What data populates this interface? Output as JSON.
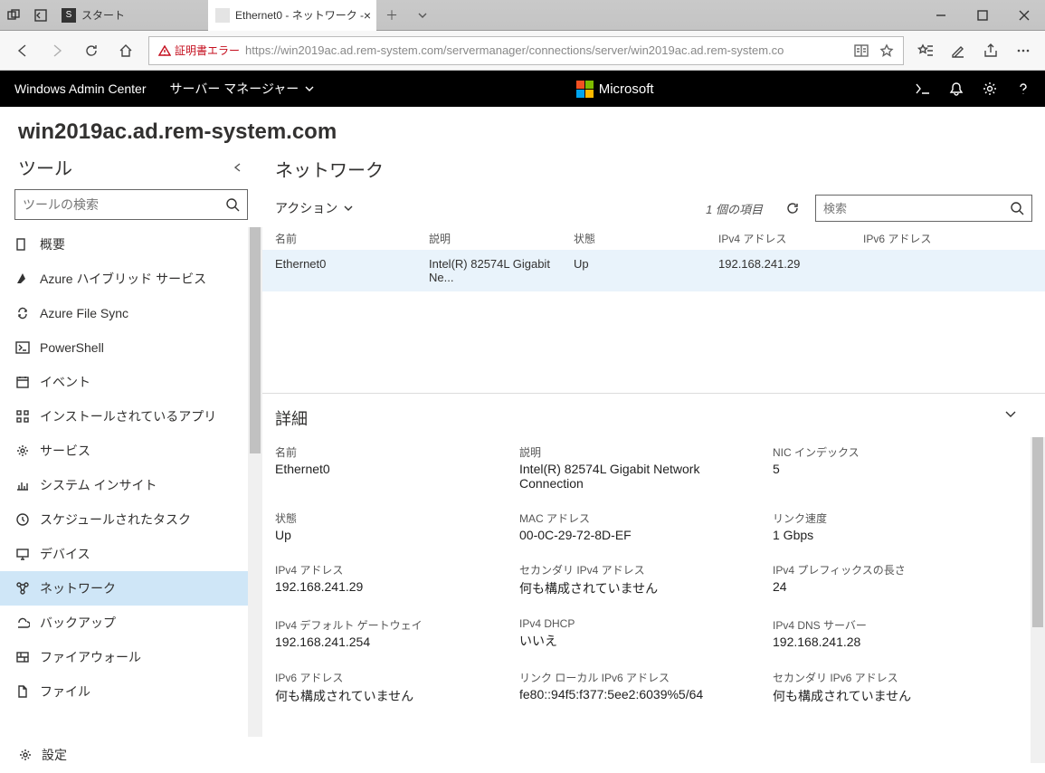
{
  "titlebar": {
    "tab1": "スタート",
    "tab2": "Ethernet0 - ネットワーク - "
  },
  "toolbar": {
    "cert_error": "証明書エラー",
    "url": "https://win2019ac.ad.rem-system.com/servermanager/connections/server/win2019ac.ad.rem-system.co"
  },
  "wac": {
    "title": "Windows Admin Center",
    "subtitle": "サーバー マネージャー",
    "brand": "Microsoft"
  },
  "server_name": "win2019ac.ad.rem-system.com",
  "tools": {
    "heading": "ツール",
    "search_placeholder": "ツールの検索",
    "items": [
      "概要",
      "Azure ハイブリッド サービス",
      "Azure File Sync",
      "PowerShell",
      "イベント",
      "インストールされているアプリ",
      "サービス",
      "システム インサイト",
      "スケジュールされたタスク",
      "デバイス",
      "ネットワーク",
      "バックアップ",
      "ファイアウォール",
      "ファイル"
    ],
    "settings": "設定"
  },
  "main": {
    "title": "ネットワーク",
    "action": "アクション",
    "count": "1 個の項目",
    "search_placeholder": "検索",
    "columns": {
      "name": "名前",
      "desc": "説明",
      "status": "状態",
      "ipv4": "IPv4 アドレス",
      "ipv6": "IPv6 アドレス"
    },
    "row": {
      "name": "Ethernet0",
      "desc": "Intel(R) 82574L Gigabit Ne...",
      "status": "Up",
      "ipv4": "192.168.241.29",
      "ipv6": ""
    }
  },
  "details": {
    "title": "詳細",
    "cells": {
      "name_l": "名前",
      "name_v": "Ethernet0",
      "desc_l": "説明",
      "desc_v": "Intel(R) 82574L Gigabit Network Connection",
      "nic_l": "NIC インデックス",
      "nic_v": "5",
      "status_l": "状態",
      "status_v": "Up",
      "mac_l": "MAC アドレス",
      "mac_v": "00-0C-29-72-8D-EF",
      "link_l": "リンク速度",
      "link_v": "1 Gbps",
      "ipv4_l": "IPv4 アドレス",
      "ipv4_v": "192.168.241.29",
      "sec4_l": "セカンダリ IPv4 アドレス",
      "sec4_v": "何も構成されていません",
      "pre4_l": "IPv4 プレフィックスの長さ",
      "pre4_v": "24",
      "gw_l": "IPv4 デフォルト ゲートウェイ",
      "gw_v": "192.168.241.254",
      "dhcp_l": "IPv4 DHCP",
      "dhcp_v": "いいえ",
      "dns_l": "IPv4 DNS サーバー",
      "dns_v": "192.168.241.28",
      "ipv6_l": "IPv6 アドレス",
      "ipv6_v": "何も構成されていません",
      "ll6_l": "リンク ローカル IPv6 アドレス",
      "ll6_v": "fe80::94f5:f377:5ee2:6039%5/64",
      "sec6_l": "セカンダリ IPv6 アドレス",
      "sec6_v": "何も構成されていません"
    }
  }
}
